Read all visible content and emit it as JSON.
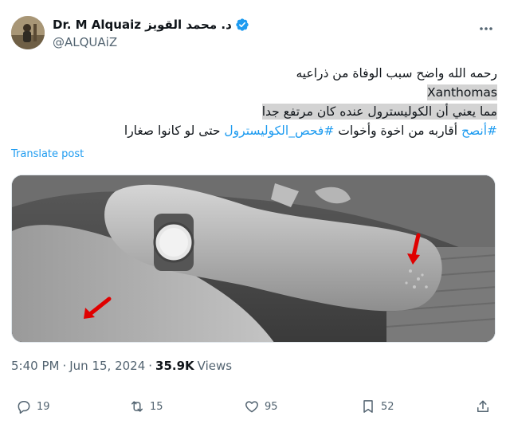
{
  "author": {
    "display_name": "Dr. M Alquaiz د. محمد القويز",
    "handle": "@ALQUAiZ",
    "verified": true,
    "verified_color": "#1d9bf0"
  },
  "post": {
    "lines": [
      "رحمه الله واضح سبب الوفاة من ذراعيه",
      "Xanthomas",
      "مما يعني أن الكوليسترول عنده كان مرتفع جدا"
    ],
    "last_line": {
      "hashtag1": "#أنصح",
      "text1": " أقاربه من اخوة وأخوات ",
      "hashtag2": "#فحص_الكوليسترول",
      "text2": " حتى لو كانوا صغارا"
    },
    "translate_label": "Translate post",
    "hashtag_color": "#1d9bf0",
    "highlight_color": "#d3d3d3"
  },
  "meta": {
    "time": "5:40 PM",
    "separator": "·",
    "date": "Jun 15, 2024",
    "separator2": "·",
    "views_count": "35.9K",
    "views_label": "Views"
  },
  "actions": {
    "replies": "19",
    "reposts": "15",
    "likes": "95",
    "bookmarks": "52"
  },
  "icons": [
    "verified-badge-icon",
    "more-options-icon",
    "reply-icon",
    "repost-icon",
    "like-icon",
    "bookmark-icon",
    "share-icon",
    "red-arrow-icon"
  ]
}
